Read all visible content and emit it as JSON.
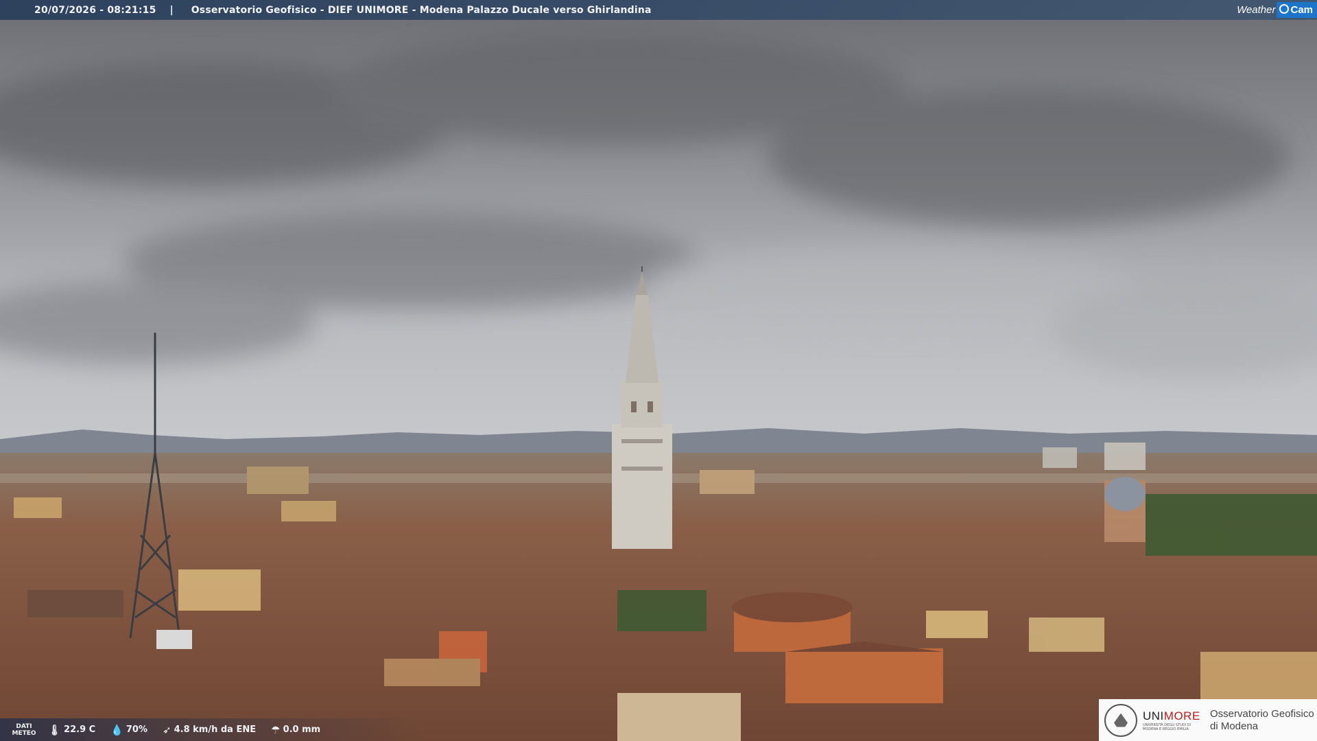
{
  "header": {
    "timestamp": "20/07/2026 - 08:21:15",
    "separator": "|",
    "title": "Osservatorio Geofisico - DIEF UNIMORE - Modena Palazzo Ducale verso Ghirlandina",
    "brand_word": "Weather",
    "brand_cam": "Cam",
    "brand_icon": "camera-lens-icon"
  },
  "weather": {
    "label_line1": "DATI",
    "label_line2": "METEO",
    "temperature": "22.9 C",
    "humidity": "70%",
    "wind": "4.8 km/h da ENE",
    "rain": "0.0 mm",
    "icons": [
      "thermometer-icon",
      "humidity-drop-icon",
      "wind-icon",
      "rain-icon"
    ]
  },
  "logo": {
    "university": "UNIMORE",
    "university_sub": "UNIVERSITÀ DEGLI STUDI DI MODENA E REGGIO EMILIA",
    "observatory_line1": "Osservatorio Geofisico",
    "observatory_line2": "di Modena"
  },
  "colors": {
    "sky": "#9a9ca1",
    "roof": "#8f5b45",
    "tower": "#c9c5bd",
    "brand_blue": "#1d74c9"
  }
}
